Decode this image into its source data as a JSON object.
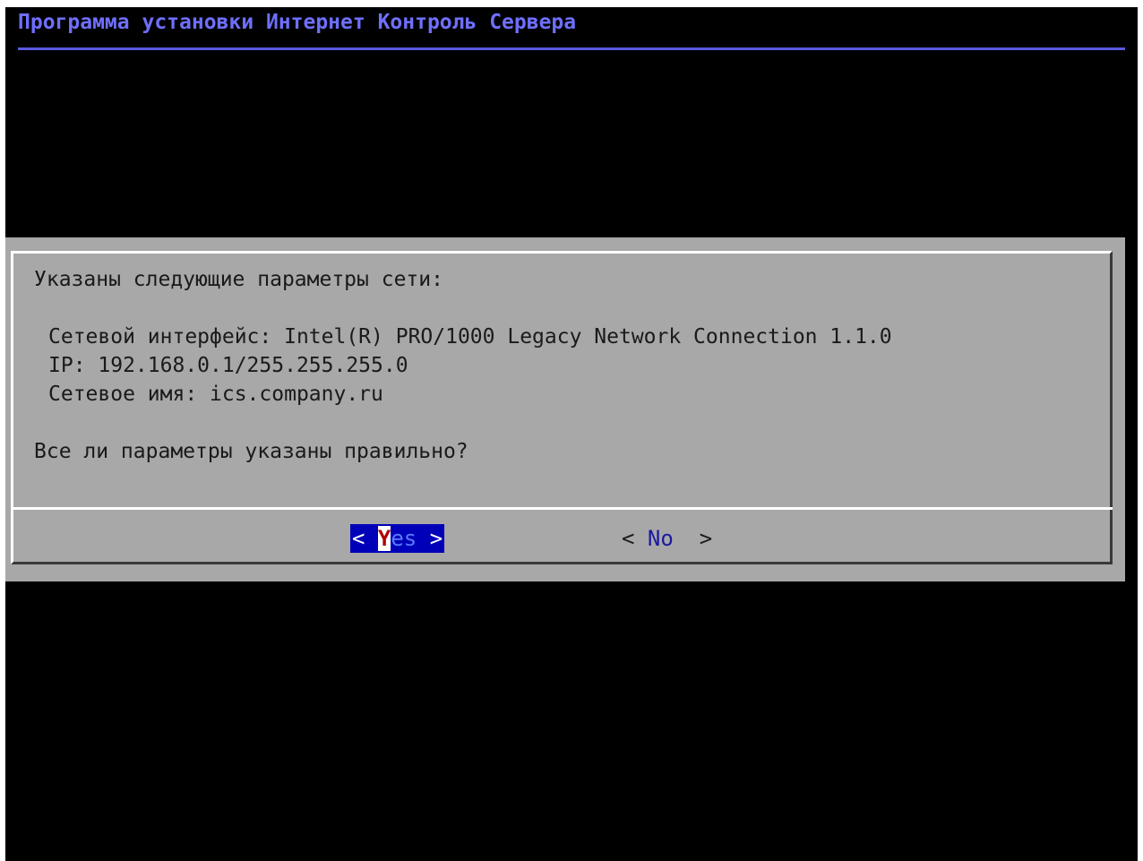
{
  "backtitle": "Программа установки Интернет Контроль Сервера",
  "dialog": {
    "header": "Указаны следующие параметры сети:",
    "lines": [
      "Сетевой интерфейс: Intel(R) PRO/1000 Legacy Network Connection 1.1.0",
      "IP: 192.168.0.1/255.255.255.0",
      "Сетевое имя: ics.company.ru"
    ],
    "question": "Все ли параметры указаны правильно?"
  },
  "buttons": {
    "yes": {
      "left_bracket": "<",
      "hotkey": "Y",
      "rest": "es",
      "right_bracket": ">"
    },
    "no": {
      "left_bracket": "<",
      "label": "No",
      "right_bracket": ">"
    }
  },
  "colors": {
    "backtitle": "#6f6fff",
    "screen": "#000000",
    "dialog": "#a8a8a8",
    "selected_button": "#0000b8"
  }
}
